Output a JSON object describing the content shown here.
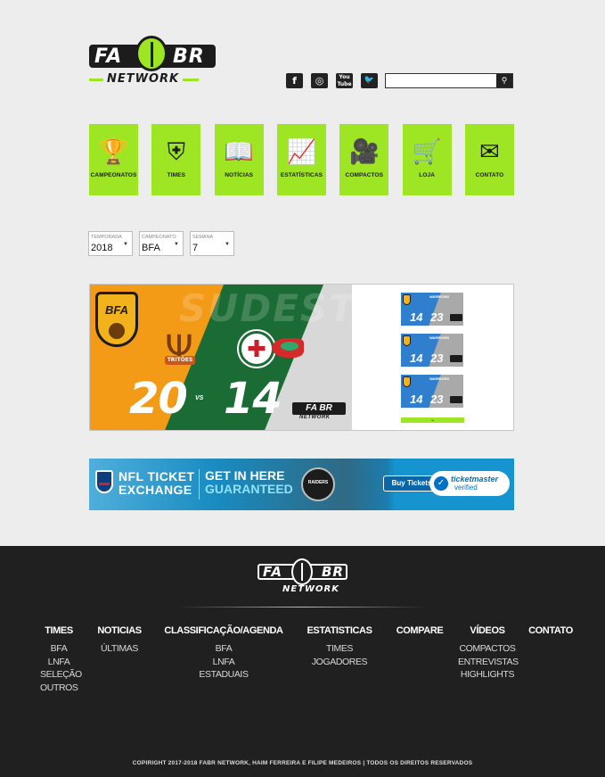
{
  "brand": {
    "logo_word_left": "FA",
    "logo_word_right": "BR",
    "logo_sub": "NETWORK"
  },
  "social": [
    {
      "name": "facebook-icon",
      "glyph": "f"
    },
    {
      "name": "instagram-icon",
      "glyph": "◎"
    },
    {
      "name": "youtube-icon",
      "glyph": "You Tube"
    },
    {
      "name": "twitter-icon",
      "glyph": "🐦"
    }
  ],
  "search": {
    "placeholder": "",
    "button_icon": "search-icon"
  },
  "tiles": [
    {
      "label": "CAMPEONATOS",
      "icon": "trophy-icon",
      "glyph": "🏆"
    },
    {
      "label": "TIMES",
      "icon": "shield-icon",
      "glyph": "⛨"
    },
    {
      "label": "NOTÍCIAS",
      "icon": "book-icon",
      "glyph": "📖"
    },
    {
      "label": "ESTATÍSTICAS",
      "icon": "chart-icon",
      "glyph": "📈"
    },
    {
      "label": "COMPACTOS",
      "icon": "camera-icon",
      "glyph": "🎥"
    },
    {
      "label": "LOJA",
      "icon": "cart-icon",
      "glyph": "🛒"
    },
    {
      "label": "CONTATO",
      "icon": "envelope-icon",
      "glyph": "✉"
    }
  ],
  "filters": [
    {
      "caption": "TEMPORADA",
      "value": "2018"
    },
    {
      "caption": "CAMPEONATO",
      "value": "BFA"
    },
    {
      "caption": "SEMANA",
      "value": "7"
    }
  ],
  "featured": {
    "region": "SUDESTE",
    "league_badge": "BFA",
    "home_team_badge": "TRITÕES",
    "home_score": "20",
    "vs": "VS",
    "away_score": "14",
    "mini_logo": "FA BR",
    "mini_sub": "NETWORK"
  },
  "thumbnails": [
    {
      "score_a": "14",
      "score_b": "23",
      "team": "WARRIORS"
    },
    {
      "score_a": "14",
      "score_b": "23",
      "team": "WARRIORS"
    },
    {
      "score_a": "14",
      "score_b": "23",
      "team": "WARRIORS"
    }
  ],
  "ad": {
    "line1": "NFL TICKET",
    "line2": "EXCHANGE",
    "cta1": "GET IN HERE",
    "cta2": "GUARANTEED",
    "team": "RAIDERS",
    "button": "Buy Tickets",
    "tm1": "ticketmaster",
    "tm2": "verified"
  },
  "footer": {
    "logo_left": "FA",
    "logo_right": "BR",
    "logo_sub": "NETWORK",
    "columns": [
      {
        "heading": "TIMES",
        "items": [
          "BFA",
          "LNFA",
          "SELEÇÃO",
          "OUTROS"
        ]
      },
      {
        "heading": "NOTICIAS",
        "items": [
          "ÚLTIMAS"
        ]
      },
      {
        "heading": "CLASSIFICAÇÃO/AGENDA",
        "items": [
          "BFA",
          "LNFA",
          "ESTADUAIS"
        ]
      },
      {
        "heading": "ESTATISTICAS",
        "items": [
          "TIMES",
          "JOGADORES"
        ]
      },
      {
        "heading": "COMPARE",
        "items": []
      },
      {
        "heading": "VÍDEOS",
        "items": [
          "COMPACTOS",
          "ENTREVISTAS",
          "HIGHLIGHTS"
        ]
      },
      {
        "heading": "CONTATO",
        "items": []
      }
    ],
    "copyright": "COPIRIGHT 2017-2018 FABR NETWORK, HAIM FERREIRA E FILIPE MEDEIROS  |  TODOS OS DIREITOS RESERVADOS"
  },
  "colors": {
    "accent": "#9ee524",
    "dark": "#1c1c1c",
    "footer_bg": "#202020",
    "page_bg": "#ededed"
  }
}
